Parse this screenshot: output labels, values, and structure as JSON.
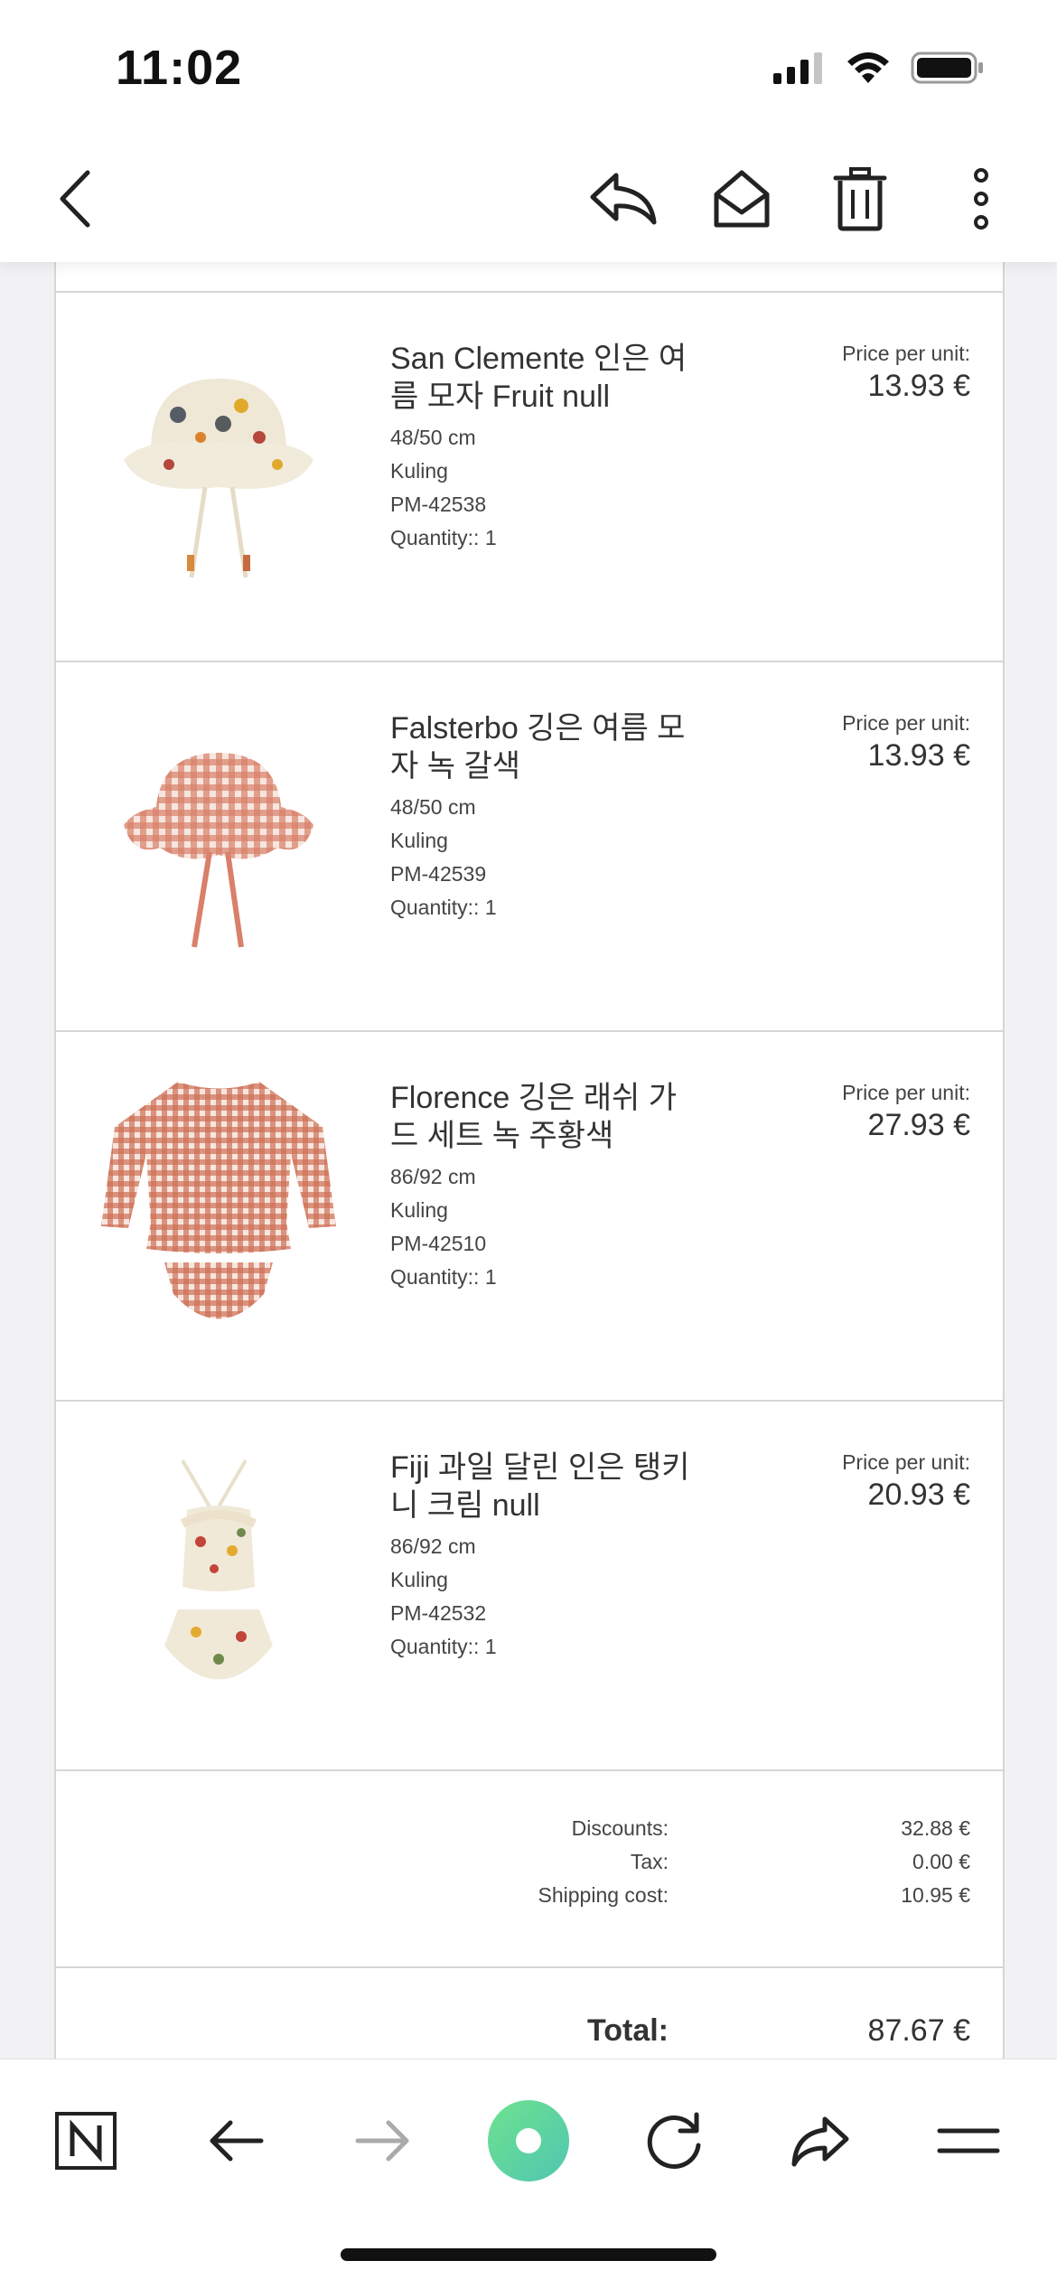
{
  "status_bar": {
    "time": "11:02"
  },
  "toolbar": {
    "back_icon": "chevron-left-icon",
    "reply_icon": "reply-icon",
    "mark_unread_icon": "envelope-open-icon",
    "delete_icon": "trash-icon",
    "more_icon": "more-vertical-icon"
  },
  "items": [
    {
      "name": "San Clemente 인은 여름 모자 Fruit null",
      "size": "48/50 cm",
      "brand": "Kuling",
      "sku": "PM-42538",
      "quantity": "Quantity:: 1",
      "price_label": "Price per unit:",
      "price": "13.93 €",
      "image": "fruit-sun-hat"
    },
    {
      "name": "Falsterbo 깅은 여름 모자 녹 갈색",
      "size": "48/50 cm",
      "brand": "Kuling",
      "sku": "PM-42539",
      "quantity": "Quantity:: 1",
      "price_label": "Price per unit:",
      "price": "13.93 €",
      "image": "gingham-sun-hat"
    },
    {
      "name": "Florence 깅은 래쉬 가드 세트 녹 주황색",
      "size": "86/92 cm",
      "brand": "Kuling",
      "sku": "PM-42510",
      "quantity": "Quantity:: 1",
      "price_label": "Price per unit:",
      "price": "27.93 €",
      "image": "gingham-rash-guard-set"
    },
    {
      "name": "Fiji 과일 달린 인은 탱키니 크림 null",
      "size": "86/92 cm",
      "brand": "Kuling",
      "sku": "PM-42532",
      "quantity": "Quantity:: 1",
      "price_label": "Price per unit:",
      "price": "20.93 €",
      "image": "fruit-tankini"
    }
  ],
  "summary": {
    "discounts_label": "Discounts:",
    "discounts_value": "32.88 €",
    "tax_label": "Tax:",
    "tax_value": "0.00 €",
    "shipping_label": "Shipping cost:",
    "shipping_value": "10.95 €",
    "total_label": "Total:",
    "total_value": "87.67 €"
  },
  "bottom_toolbar": {
    "icons": [
      "notion-logo-icon",
      "arrow-left-icon",
      "arrow-right-icon",
      "record-icon",
      "refresh-icon",
      "share-icon",
      "menu-icon"
    ],
    "accent_color": "#5fd4a0"
  }
}
